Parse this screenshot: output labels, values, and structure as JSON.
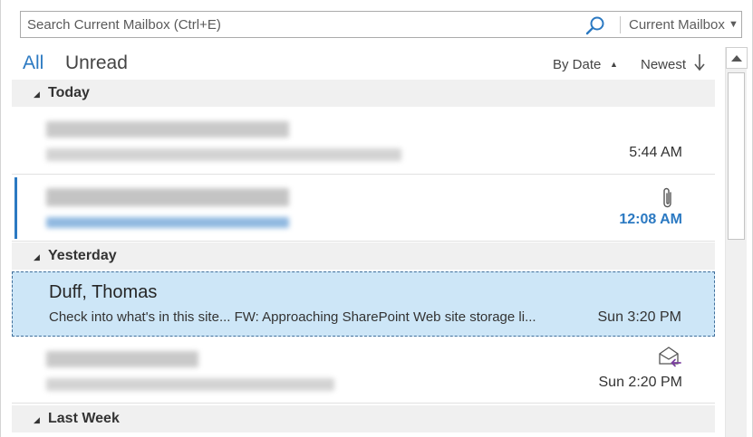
{
  "search": {
    "placeholder": "Search Current Mailbox (Ctrl+E)",
    "scope_label": "Current Mailbox",
    "scope_caret": "▼"
  },
  "filters": {
    "all_label": "All",
    "unread_label": "Unread",
    "sort_by_label": "By Date",
    "sort_caret": "▲",
    "sort_order_label": "Newest"
  },
  "groups": [
    {
      "label": "Today",
      "toggle": "◢"
    },
    {
      "label": "Yesterday",
      "toggle": "◢"
    },
    {
      "label": "Last Week",
      "toggle": "◢"
    }
  ],
  "messages": [
    {
      "sender": "",
      "preview": "",
      "time": "5:44 AM",
      "unread": false,
      "selected": false,
      "redacted": true,
      "icon": ""
    },
    {
      "sender": "",
      "preview": "",
      "time": "12:08 AM",
      "unread": true,
      "selected": false,
      "redacted": true,
      "icon": "paperclip-icon"
    },
    {
      "sender": "Duff, Thomas",
      "preview": "Check into what's in this site... FW: Approaching SharePoint Web site storage li...",
      "time": "Sun 3:20 PM",
      "unread": false,
      "selected": true,
      "redacted": false,
      "icon": ""
    },
    {
      "sender": "",
      "preview": "",
      "time": "Sun 2:20 PM",
      "unread": false,
      "selected": false,
      "redacted": true,
      "icon": "replied-envelope-icon"
    }
  ],
  "colors": {
    "accent": "#2b79c2",
    "selected_bg": "#cde6f7",
    "group_header_bg": "#f0f0f0"
  }
}
